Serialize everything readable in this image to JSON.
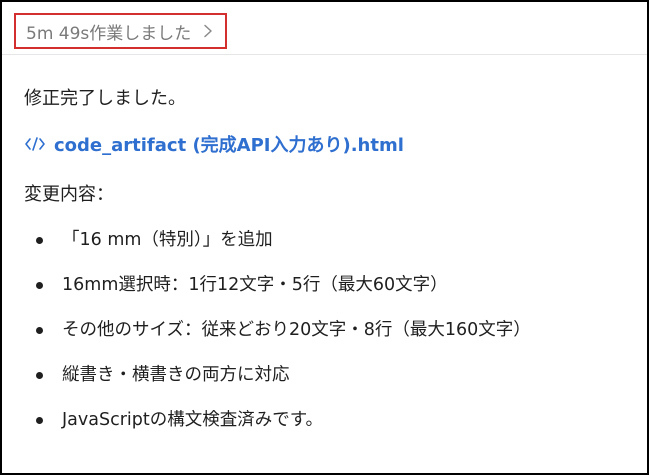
{
  "header": {
    "work_time_label": "5m 49s作業しました"
  },
  "message": {
    "text": "修正完了しました。"
  },
  "artifact": {
    "name": "code_artifact (完成API入力あり).html",
    "icon": "code-icon",
    "color": "#2f6fcf"
  },
  "changes": {
    "heading": "変更内容：",
    "items": [
      "「16 mm（特別）」を追加",
      "16mm選択時：1行12文字・5行（最大60文字）",
      "その他のサイズ：従来どおり20文字・8行（最大160文字）",
      "縦書き・横書きの両方に対応",
      "JavaScriptの構文検査済みです。"
    ]
  },
  "colors": {
    "highlight_border": "#d32f2f",
    "link": "#2f6fcf",
    "muted_text": "#7a7a7a"
  }
}
